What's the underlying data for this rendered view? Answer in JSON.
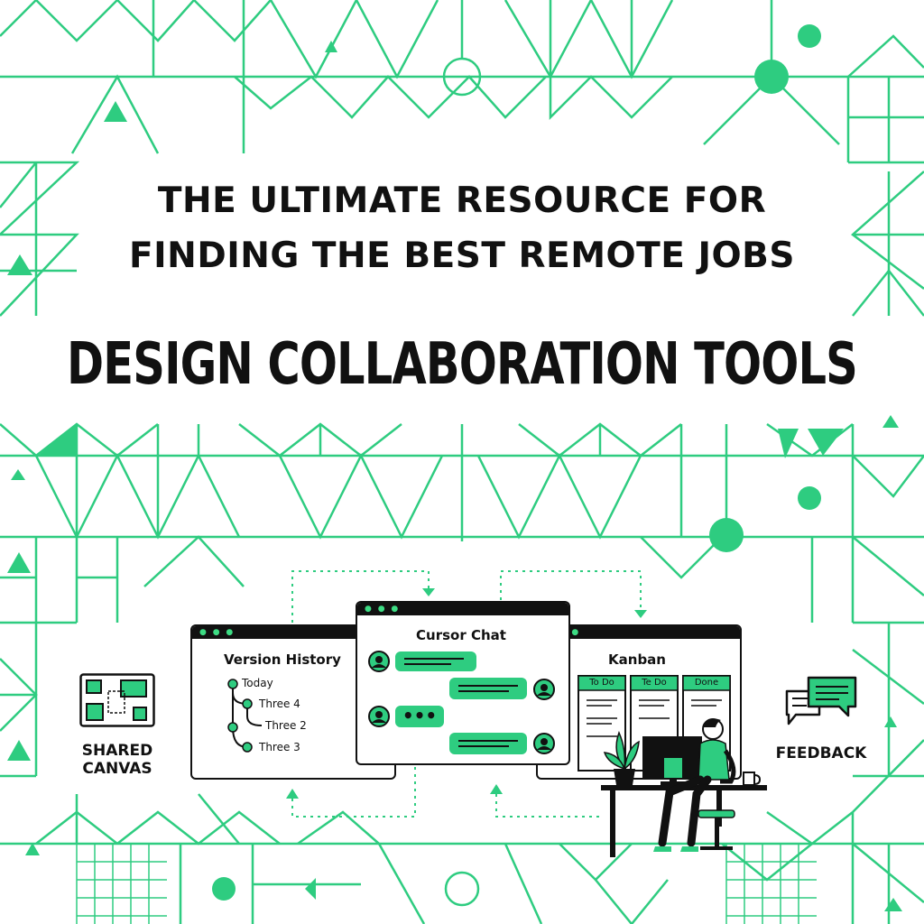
{
  "headline": {
    "line1": "THE ULTIMATE RESOURCE FOR",
    "line2": "FINDING THE BEST REMOTE JOBS",
    "main": "DESIGN COLLABORATION TOOLS"
  },
  "labels": {
    "shared_canvas_1": "SHARED",
    "shared_canvas_2": "CANVAS",
    "feedback": "FEEDBACK"
  },
  "version_history": {
    "title": "Version History",
    "items": [
      "Today",
      "Three 4",
      "Three 2",
      "Three 3"
    ]
  },
  "cursor_chat": {
    "title": "Cursor Chat",
    "typing": "•••"
  },
  "kanban": {
    "title": "Kanban",
    "columns": [
      "To Do",
      "Te Do",
      "Done"
    ]
  },
  "colors": {
    "accent": "#2ecc80",
    "ink": "#111111",
    "background": "#ffffff"
  },
  "icons": [
    "shared-canvas-icon",
    "feedback-icon",
    "avatar-icon",
    "plant-icon",
    "monitor-icon",
    "mug-icon"
  ]
}
